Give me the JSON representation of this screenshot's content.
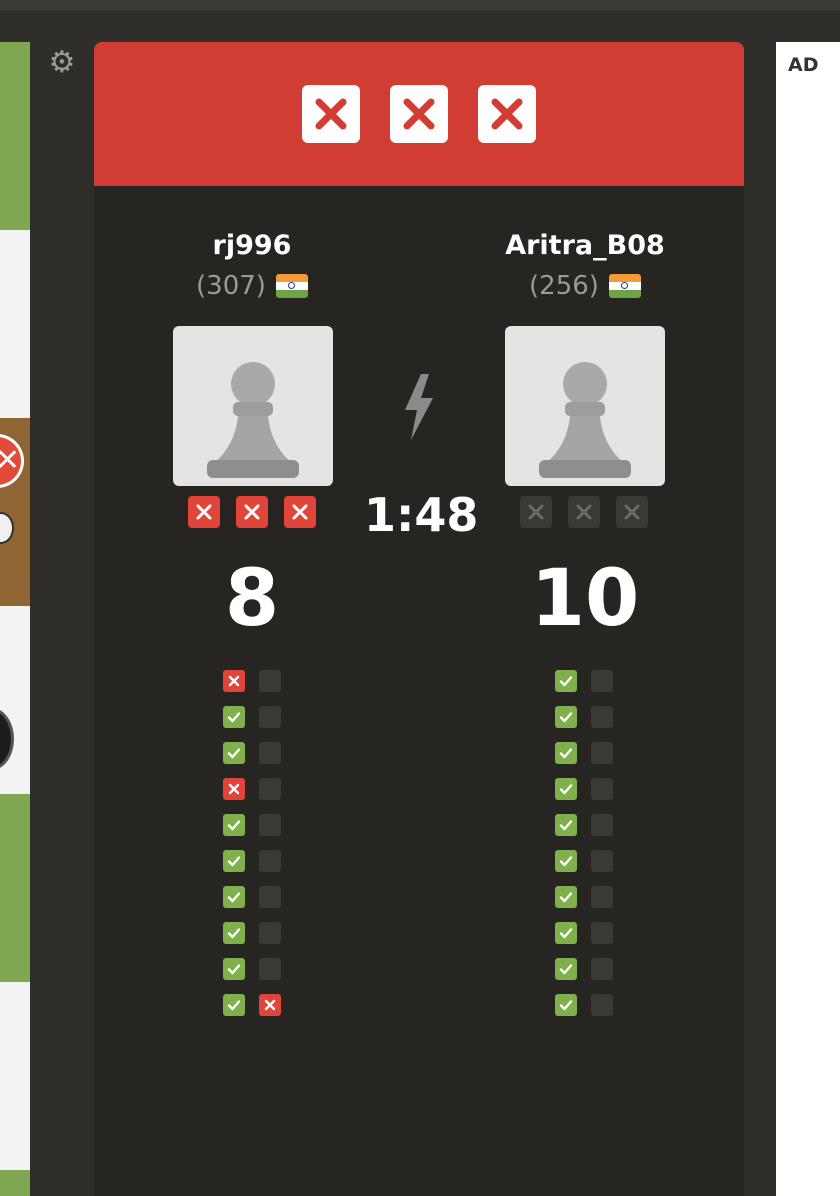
{
  "ad_label": "AD",
  "players": [
    {
      "name": "rj996",
      "rating": "(307)",
      "flag": "india-flag",
      "score": "8",
      "strikes_used": 3,
      "results": [
        [
          "fail",
          "empty"
        ],
        [
          "pass",
          "empty"
        ],
        [
          "pass",
          "empty"
        ],
        [
          "fail",
          "empty"
        ],
        [
          "pass",
          "empty"
        ],
        [
          "pass",
          "empty"
        ],
        [
          "pass",
          "empty"
        ],
        [
          "pass",
          "empty"
        ],
        [
          "pass",
          "empty"
        ],
        [
          "pass",
          "fail"
        ]
      ]
    },
    {
      "name": "Aritra_B08",
      "rating": "(256)",
      "flag": "india-flag",
      "score": "10",
      "strikes_used": 0,
      "results": [
        [
          "pass",
          "empty"
        ],
        [
          "pass",
          "empty"
        ],
        [
          "pass",
          "empty"
        ],
        [
          "pass",
          "empty"
        ],
        [
          "pass",
          "empty"
        ],
        [
          "pass",
          "empty"
        ],
        [
          "pass",
          "empty"
        ],
        [
          "pass",
          "empty"
        ],
        [
          "pass",
          "empty"
        ],
        [
          "pass",
          "empty"
        ]
      ]
    }
  ],
  "timer": "1:48",
  "mode_icon": "lightning-bolt-icon",
  "colors": {
    "banner": "#d13c33",
    "pass": "#7fb04b",
    "fail": "#e0443a",
    "panel": "#262522"
  }
}
